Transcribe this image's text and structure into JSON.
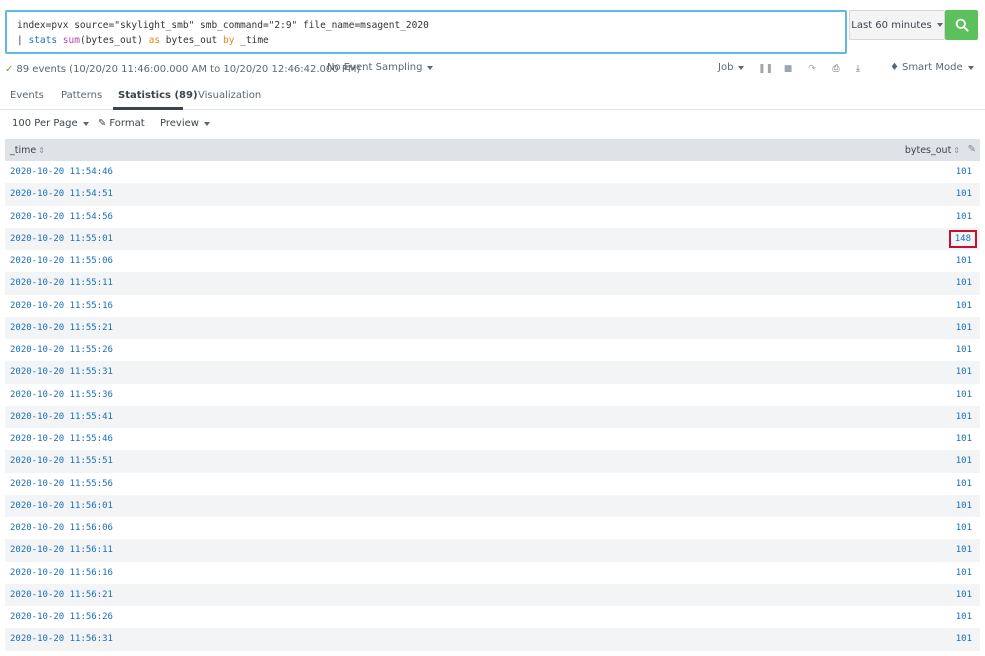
{
  "search": {
    "line1": "index=pvx source=\"skylight_smb\" smb_command=\"2:9\" file_name=msagent_2020",
    "line2_pipe": "| ",
    "line2_cmd": "stats",
    "line2_fn": "sum",
    "line2_args": "(bytes_out) ",
    "line2_kw_as": "as",
    "line2_field": " bytes_out ",
    "line2_kw_by": "by",
    "line2_tail": " _time",
    "time_range_label": "Last 60 minutes",
    "search_button_icon": "magnifier-icon"
  },
  "status": {
    "event_count": "89 events (10/20/20 11:46:00.000 AM to 10/20/20 12:46:42.000 PM)",
    "sampling": "No Event Sampling",
    "job": "Job",
    "mode": "Smart Mode"
  },
  "tabs": [
    {
      "label": "Events"
    },
    {
      "label": "Patterns"
    },
    {
      "label": "Statistics (89)"
    },
    {
      "label": "Visualization"
    }
  ],
  "format_bar": {
    "per_page": "100 Per Page",
    "format": "Format",
    "preview": "Preview"
  },
  "table": {
    "columns": [
      "_time",
      "bytes_out"
    ],
    "rows": [
      {
        "time": "2020-10-20 11:54:46",
        "bytes_out": "101"
      },
      {
        "time": "2020-10-20 11:54:51",
        "bytes_out": "101"
      },
      {
        "time": "2020-10-20 11:54:56",
        "bytes_out": "101"
      },
      {
        "time": "2020-10-20 11:55:01",
        "bytes_out": "148"
      },
      {
        "time": "2020-10-20 11:55:06",
        "bytes_out": "101"
      },
      {
        "time": "2020-10-20 11:55:11",
        "bytes_out": "101"
      },
      {
        "time": "2020-10-20 11:55:16",
        "bytes_out": "101"
      },
      {
        "time": "2020-10-20 11:55:21",
        "bytes_out": "101"
      },
      {
        "time": "2020-10-20 11:55:26",
        "bytes_out": "101"
      },
      {
        "time": "2020-10-20 11:55:31",
        "bytes_out": "101"
      },
      {
        "time": "2020-10-20 11:55:36",
        "bytes_out": "101"
      },
      {
        "time": "2020-10-20 11:55:41",
        "bytes_out": "101"
      },
      {
        "time": "2020-10-20 11:55:46",
        "bytes_out": "101"
      },
      {
        "time": "2020-10-20 11:55:51",
        "bytes_out": "101"
      },
      {
        "time": "2020-10-20 11:55:56",
        "bytes_out": "101"
      },
      {
        "time": "2020-10-20 11:56:01",
        "bytes_out": "101"
      },
      {
        "time": "2020-10-20 11:56:06",
        "bytes_out": "101"
      },
      {
        "time": "2020-10-20 11:56:11",
        "bytes_out": "101"
      },
      {
        "time": "2020-10-20 11:56:16",
        "bytes_out": "101"
      },
      {
        "time": "2020-10-20 11:56:21",
        "bytes_out": "101"
      },
      {
        "time": "2020-10-20 11:56:26",
        "bytes_out": "101"
      },
      {
        "time": "2020-10-20 11:56:31",
        "bytes_out": "101"
      }
    ]
  },
  "colors": {
    "search_border": "#5fb8e8",
    "search_button": "#5cc05c",
    "link_blue": "#1a6fb5",
    "highlight_box": "#c8102e",
    "header_bg": "#dfe3e8"
  }
}
